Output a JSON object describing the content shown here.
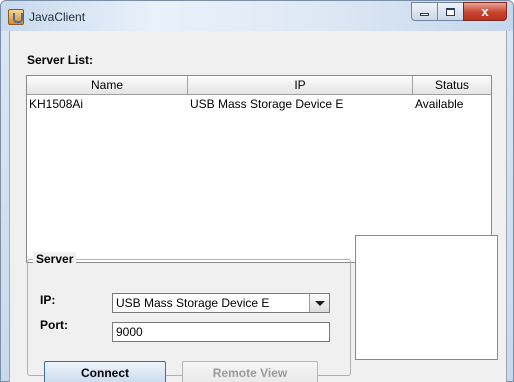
{
  "window": {
    "title": "JavaClient",
    "close_glyph": "x"
  },
  "server_list": {
    "label": "Server List:",
    "columns": [
      "Name",
      "IP",
      "Status"
    ],
    "rows": [
      {
        "name": "KH1508Ai",
        "ip": "USB Mass Storage Device E",
        "status": "Available"
      }
    ]
  },
  "server_panel": {
    "legend": "Server",
    "ip_label": "IP:",
    "ip_selected": "USB Mass Storage Device E",
    "port_label": "Port:",
    "port_value": "9000",
    "connect_label": "Connect",
    "remote_view_label": "Remote View"
  },
  "colors": {
    "title_close": "#c6442f",
    "connect_border": "#3c6fa8",
    "disabled_text": "#9a9a9a"
  },
  "icons": [
    "java-app-icon",
    "minimize-icon",
    "maximize-icon",
    "close-icon",
    "dropdown-arrow-icon"
  ]
}
